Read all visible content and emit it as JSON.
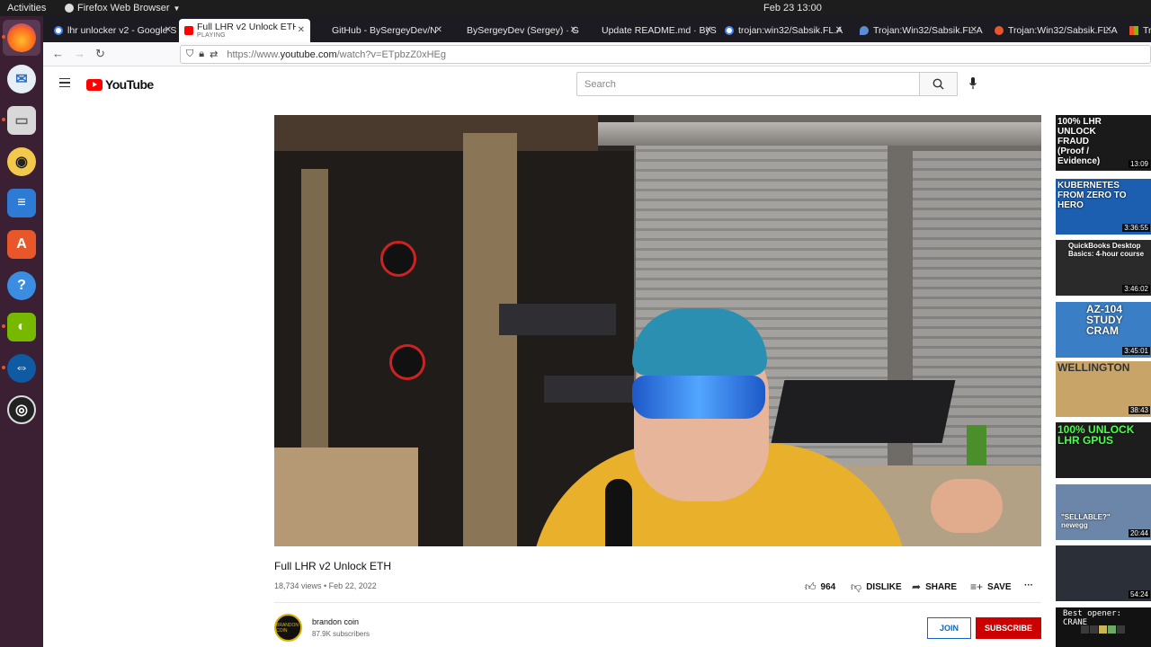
{
  "system": {
    "activities": "Activities",
    "app_menu": "Firefox Web Browser",
    "clock": "Feb 23  13:00"
  },
  "browser": {
    "tabs": [
      {
        "title": "lhr unlocker v2 - Google S",
        "active": false
      },
      {
        "title": "Full LHR v2 Unlock ETH - Y",
        "active": true,
        "status": "PLAYING"
      },
      {
        "title": "GitHub - BySergeyDev/N",
        "active": false
      },
      {
        "title": "BySergeyDev (Sergey) · G",
        "active": false
      },
      {
        "title": "Update README.md · ByS",
        "active": false
      },
      {
        "title": "trojan:win32/Sabsik.FL.A",
        "active": false
      },
      {
        "title": "Trojan:Win32/Sabsik.FL.A",
        "active": false
      },
      {
        "title": "Trojan:Win32/Sabsik.FL.A",
        "active": false
      },
      {
        "title": "Tro",
        "active": false
      }
    ],
    "url_prefix": "https://www.",
    "url_domain": "youtube.com",
    "url_path": "/watch?v=ETpbzZ0xHEg"
  },
  "youtube": {
    "logo_text": "YouTube",
    "search_placeholder": "Search",
    "video": {
      "title": "Full LHR v2 Unlock ETH",
      "meta": "18,734 views • Feb 22, 2022",
      "likes": "964",
      "dislike_label": "DISLIKE",
      "share_label": "SHARE",
      "save_label": "SAVE",
      "more_label": "···"
    },
    "channel": {
      "name": "brandon coin",
      "subscribers": "87.9K subscribers",
      "avatar_text": "BRANDON COIN",
      "join_label": "JOIN",
      "subscribe_label": "SUBSCRIBE"
    },
    "sidebar": [
      {
        "title": "100% LHR UNLOCK FRAUD (Proof / Evidence)",
        "duration": "13:09",
        "color": "#1a1a1a"
      },
      {
        "title": "KUBERNETES FROM ZERO TO HERO",
        "duration": "3:36:55",
        "color": "#1c5fb0"
      },
      {
        "title": "QuickBooks Desktop Basics: 4-hour course",
        "duration": "3:46:02",
        "color": "#2a2a2a"
      },
      {
        "title": "AZ-104 STUDY CRAM",
        "duration": "3:45:01",
        "color": "#3a7fc6"
      },
      {
        "title": "WELLINGTON",
        "duration": "38:43",
        "color": "#c8a468"
      },
      {
        "title": "100% UNLOCK LHR GPUS",
        "duration": "",
        "color": "#1d1d1d"
      },
      {
        "title": "\"SELLABLE?\" newegg",
        "duration": "20:44",
        "color": "#6b86a8"
      },
      {
        "title": "",
        "duration": "54:24",
        "color": "#2b2f38"
      }
    ],
    "wordle_text": "Best opener: CRANE"
  }
}
